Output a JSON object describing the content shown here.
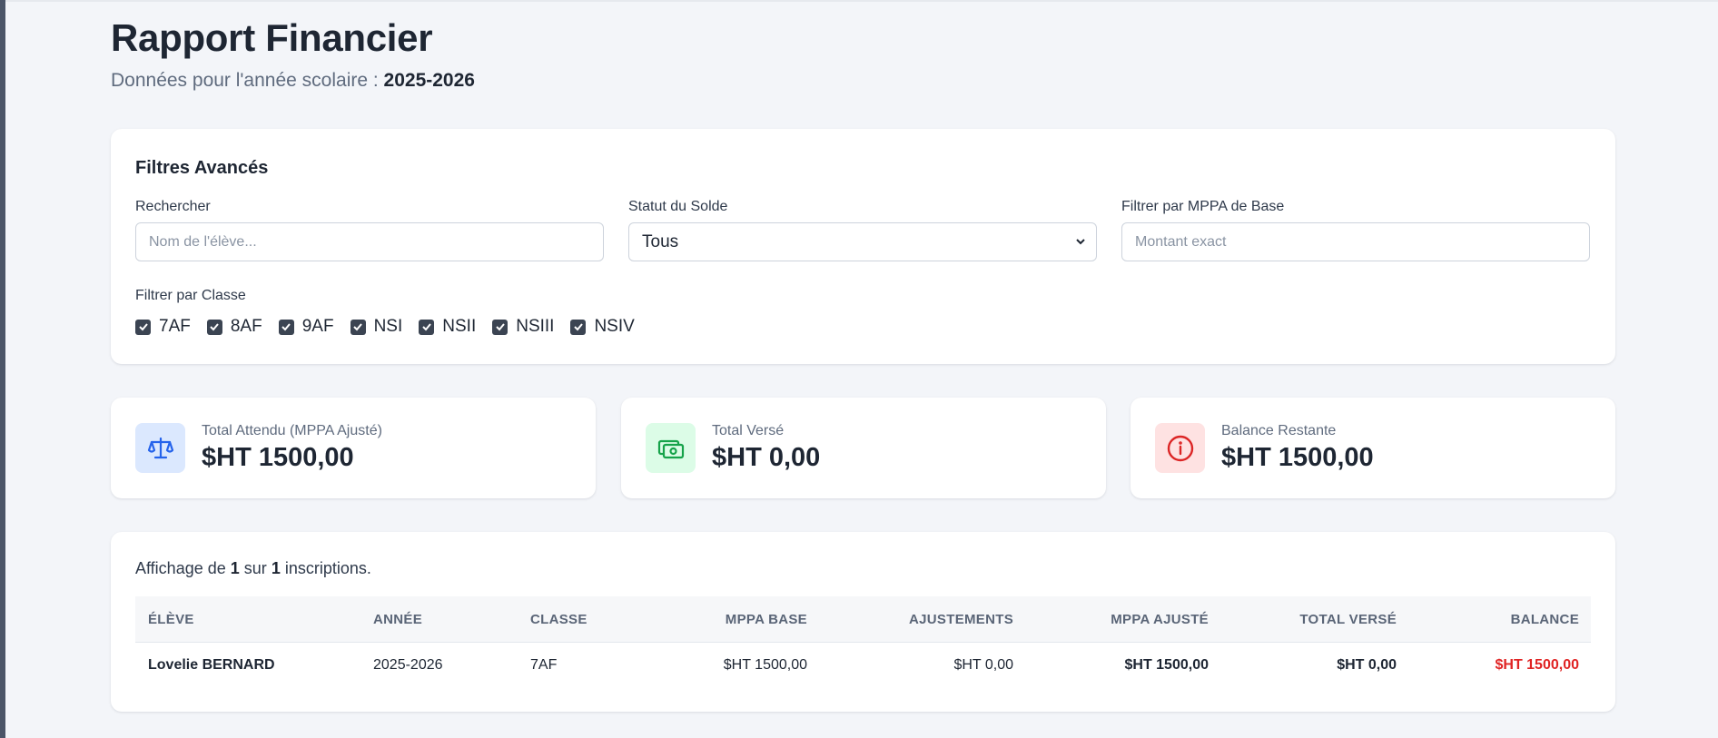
{
  "header": {
    "title": "Rapport Financier",
    "subtitle_prefix": "Données pour l'année scolaire :",
    "year": "2025-2026"
  },
  "filters": {
    "title": "Filtres Avancés",
    "search": {
      "label": "Rechercher",
      "placeholder": "Nom de l'élève..."
    },
    "status": {
      "label": "Statut du Solde",
      "value": "Tous"
    },
    "mppa": {
      "label": "Filtrer par MPPA de Base",
      "placeholder": "Montant exact"
    },
    "class_label": "Filtrer par Classe",
    "classes": [
      {
        "label": "7AF",
        "checked": true
      },
      {
        "label": "8AF",
        "checked": true
      },
      {
        "label": "9AF",
        "checked": true
      },
      {
        "label": "NSI",
        "checked": true
      },
      {
        "label": "NSII",
        "checked": true
      },
      {
        "label": "NSIII",
        "checked": true
      },
      {
        "label": "NSIV",
        "checked": true
      }
    ]
  },
  "stats": [
    {
      "label": "Total Attendu (MPPA Ajusté)",
      "value": "$HT 1500,00",
      "icon": "scale-icon",
      "icon_color": "#2563eb",
      "icon_bg": "#dbe8fe"
    },
    {
      "label": "Total Versé",
      "value": "$HT 0,00",
      "icon": "money-icon",
      "icon_color": "#16a34a",
      "icon_bg": "#dcfce7"
    },
    {
      "label": "Balance Restante",
      "value": "$HT 1500,00",
      "icon": "info-icon",
      "icon_color": "#dc2626",
      "icon_bg": "#fee2e2"
    }
  ],
  "table": {
    "summary": {
      "prefix": "Affichage de",
      "shown": "1",
      "middle": "sur",
      "total": "1",
      "suffix": "inscriptions."
    },
    "columns": [
      "ÉLÈVE",
      "ANNÉE",
      "CLASSE",
      "MPPA BASE",
      "AJUSTEMENTS",
      "MPPA AJUSTÉ",
      "TOTAL VERSÉ",
      "BALANCE"
    ],
    "rows": [
      [
        "Lovelie BERNARD",
        "2025-2026",
        "7AF",
        "$HT 1500,00",
        "$HT 0,00",
        "$HT 1500,00",
        "$HT 0,00",
        "$HT 1500,00"
      ]
    ]
  },
  "colors": {
    "balance_negative": "#e02424",
    "checkbox": "#3b4452"
  }
}
